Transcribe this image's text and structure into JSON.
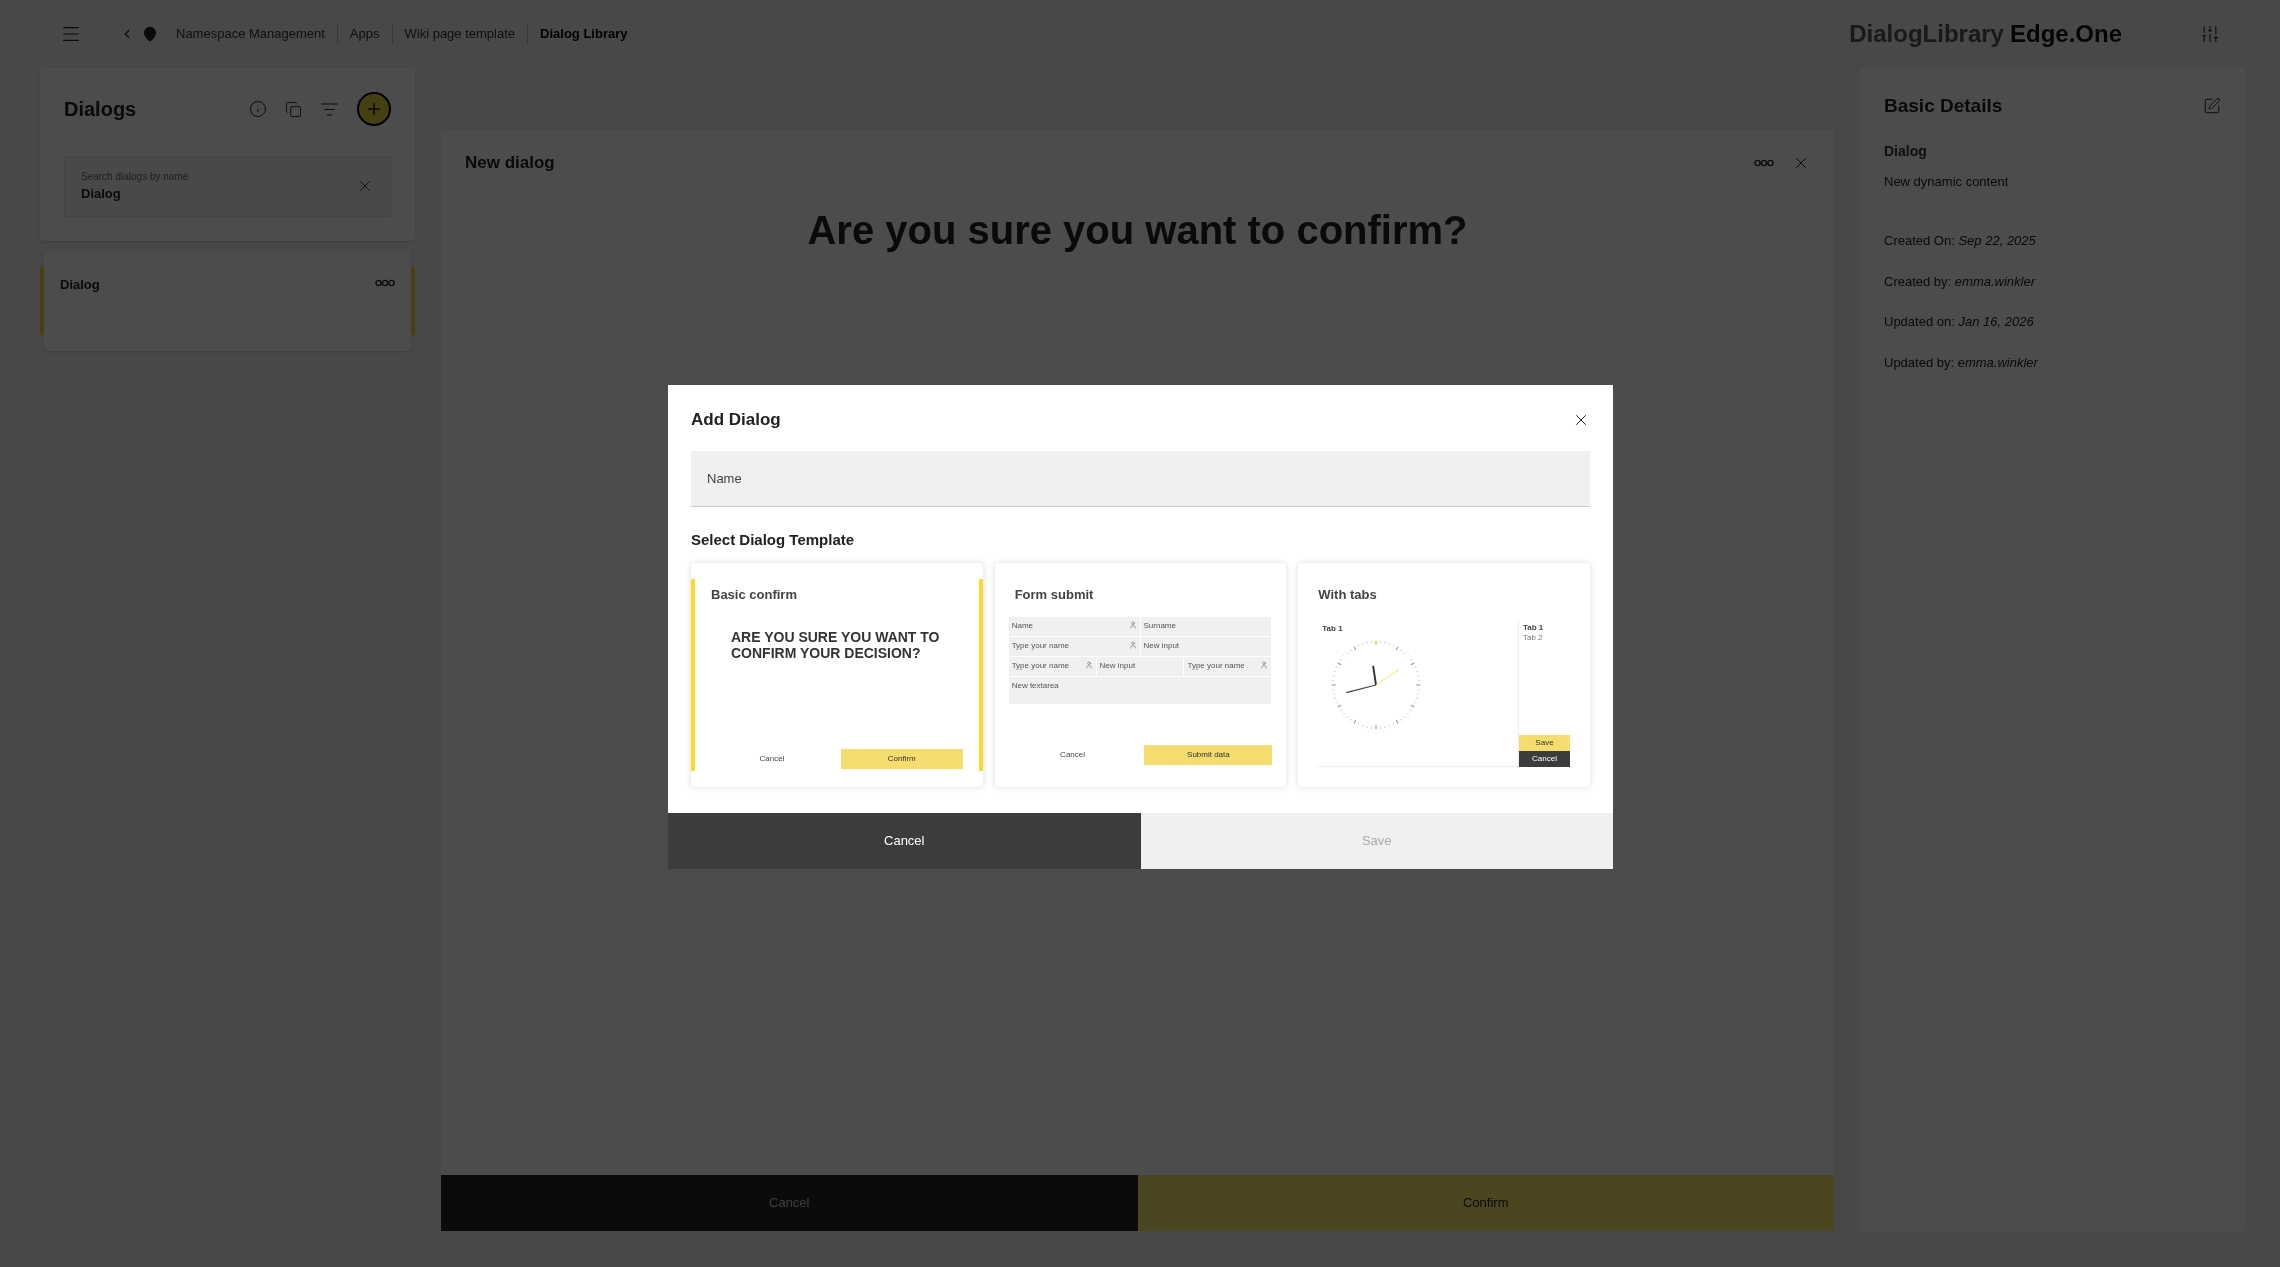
{
  "top_bar": {
    "breadcrumbs": [
      {
        "label": "Namespace Management",
        "current": false
      },
      {
        "label": "Apps",
        "current": false
      },
      {
        "label": "Wiki page template",
        "current": false
      },
      {
        "label": "Dialog Library",
        "current": true
      }
    ],
    "app_name": "DialogLibrary",
    "brand": "Edge.One"
  },
  "dialogs_panel": {
    "title": "Dialogs",
    "search": {
      "label": "Search dialogs by name",
      "value": "Dialog"
    },
    "items": [
      {
        "name": "Dialog",
        "selected": true
      }
    ]
  },
  "editor": {
    "title": "New dialog",
    "heading": "Are you sure you want to confirm?",
    "buttons": [
      {
        "label": "Cancel",
        "kind": "secondary"
      },
      {
        "label": "Confirm",
        "kind": "primary"
      }
    ]
  },
  "details": {
    "title": "Basic Details",
    "name": "Dialog",
    "description": "New dynamic content",
    "fields": [
      {
        "label": "Created On:",
        "value": "Sep 22, 2025"
      },
      {
        "label": "Created by:",
        "value": "emma.winkler"
      },
      {
        "label": "Updated on:",
        "value": "Jan 16, 2026"
      },
      {
        "label": "Updated by:",
        "value": "emma.winkler"
      }
    ]
  },
  "modal": {
    "title": "Add Dialog",
    "name_field": {
      "placeholder": "Name"
    },
    "section_title": "Select Dialog Template",
    "templates": [
      {
        "kind": "confirm",
        "title": "Basic confirm",
        "selected": true,
        "preview": {
          "question": "ARE YOU SURE YOU WANT TO CONFIRM YOUR DECISION?",
          "buttons": [
            "Cancel",
            "Confirm"
          ]
        }
      },
      {
        "kind": "form",
        "title": "Form submit",
        "selected": false,
        "preview": {
          "rows": [
            [
              {
                "text": "Name",
                "icon": true
              },
              {
                "text": "Surname",
                "icon": false
              }
            ],
            [
              {
                "text": "Type your name",
                "icon": true
              },
              {
                "text": "New input",
                "icon": false
              }
            ],
            [
              {
                "text": "Type your name",
                "icon": true
              },
              {
                "text": "New input",
                "icon": false
              },
              {
                "text": "Type your name",
                "icon": true
              }
            ],
            [
              {
                "text": "New textarea",
                "icon": false
              }
            ]
          ],
          "buttons": [
            "Cancel",
            "Submit data"
          ]
        }
      },
      {
        "kind": "tabs",
        "title": "With tabs",
        "selected": false,
        "preview": {
          "tab_title": "Tab 1",
          "side_tabs": [
            "Tab 1",
            "Tab 2"
          ],
          "buttons": [
            "Save",
            "Cancel"
          ]
        }
      }
    ],
    "buttons": [
      {
        "label": "Cancel",
        "kind": "secondary",
        "disabled": false
      },
      {
        "label": "Save",
        "kind": "primary",
        "disabled": true
      }
    ]
  }
}
